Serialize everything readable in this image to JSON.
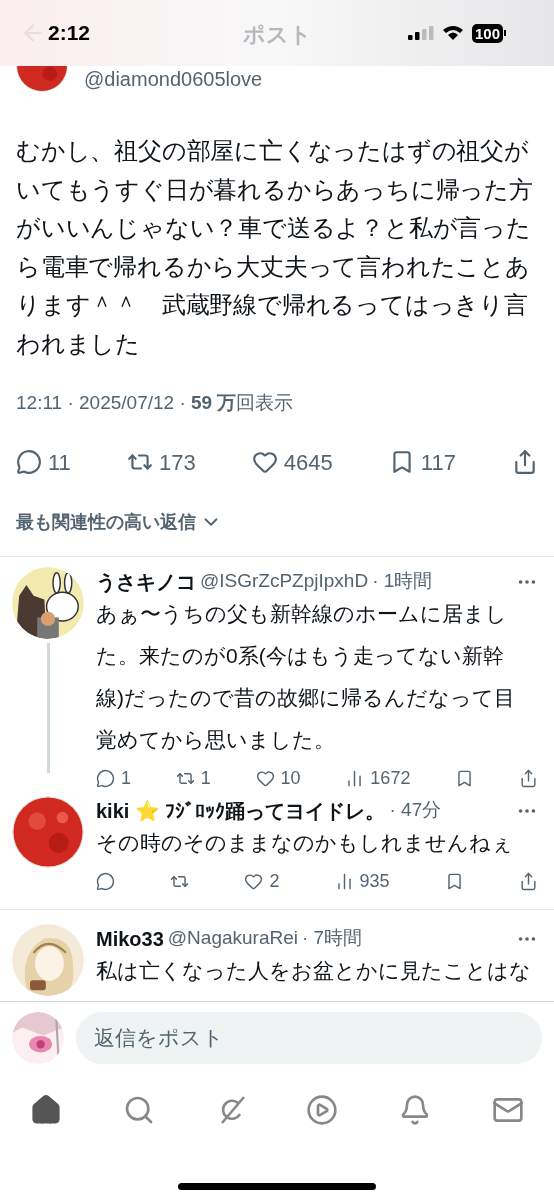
{
  "status_bar": {
    "time": "2:12",
    "battery": "100"
  },
  "header": {
    "title": "ポスト"
  },
  "post": {
    "handle": "@diamond0605love",
    "text": "むかし、祖父の部屋に亡くなったはずの祖父がいてもうすぐ日が暮れるからあっちに帰った方がいいんじゃない？車で送るよ？と私が言ったら電車で帰れるから大丈夫って言われたことあります＾＾　武蔵野線で帰れるってはっきり言われました",
    "meta": "12:11 · 2025/07/12 · **59 万**回表示",
    "actions": [
      {
        "kind": "reply",
        "count": "11"
      },
      {
        "kind": "repost",
        "count": "173"
      },
      {
        "kind": "like",
        "count": "4645"
      },
      {
        "kind": "bookmark",
        "count": "117"
      },
      {
        "kind": "share"
      }
    ]
  },
  "sort": {
    "label": "最も関連性の高い返信"
  },
  "replies": [
    {
      "name": "うさキノコ",
      "handle": "@ISGrZcPZpjIpxhD",
      "time": "· 1時間",
      "thread": true,
      "text": "あぁ〜うちの父も新幹線のホームに居ました。来たのが0系(今はもう走ってない新幹線)だったので昔の故郷に帰るんだなって目覚めてから思いました。",
      "actions": [
        {
          "kind": "reply",
          "count": "1"
        },
        {
          "kind": "repost",
          "count": "1"
        },
        {
          "kind": "like",
          "count": "10"
        },
        {
          "kind": "views",
          "count": "1672"
        },
        {
          "kind": "bookmark"
        },
        {
          "kind": "share"
        }
      ]
    },
    {
      "name": "kiki ⭐ ﾌｼﾞﾛｯｸ踊ってヨイドレ。",
      "time": "· 47分",
      "thread": false,
      "text": "その時のそのままなのかもしれませんねぇ",
      "actions": [
        {
          "kind": "reply"
        },
        {
          "kind": "repost"
        },
        {
          "kind": "like",
          "count": "2"
        },
        {
          "kind": "views",
          "count": "935"
        },
        {
          "kind": "bookmark"
        },
        {
          "kind": "share"
        }
      ]
    },
    {
      "name": "Miko33",
      "handle": "@NagakuraRei",
      "time": "· 7時間",
      "thread": false,
      "text": "私は亡くなった人をお盆とかに見たことはな"
    }
  ],
  "reply_box": {
    "placeholder": "返信をポスト"
  },
  "nav": [
    {
      "kind": "home",
      "selected": true
    },
    {
      "kind": "search",
      "selected": false
    },
    {
      "kind": "grok",
      "selected": false
    },
    {
      "kind": "video",
      "selected": false
    },
    {
      "kind": "notifications",
      "selected": false
    },
    {
      "kind": "messages",
      "selected": false
    }
  ]
}
